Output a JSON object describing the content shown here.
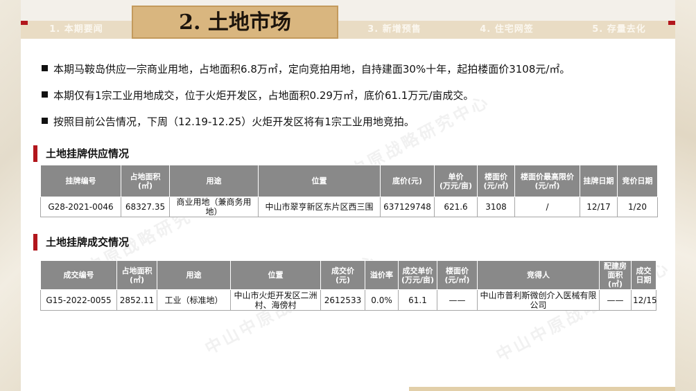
{
  "tabs": [
    "1. 本期要闻",
    "2. 土地市场",
    "3. 新增预售",
    "4. 住宅网签",
    "5. 存量去化"
  ],
  "bullets": [
    "本期马鞍岛供应一宗商业用地，占地面积6.8万㎡，定向竞拍用地，自持建面30%十年，起拍楼面价3108元/㎡。",
    "本期仅有1宗工业用地成交，位于火炬开发区，占地面积0.29万㎡，底价61.1万元/亩成交。",
    "按照目前公告情况，下周（12.19-12.25）火炬开发区将有1宗工业用地竞拍。"
  ],
  "supply": {
    "title": "土地挂牌供应情况",
    "headers": [
      "挂牌编号",
      "占地面积\n(㎡)",
      "用途",
      "位置",
      "底价(元)",
      "单价\n(万元/亩)",
      "楼面价\n(元/㎡)",
      "楼面价最高限价\n(元/㎡)",
      "挂牌日期",
      "竞价日期"
    ],
    "rows": [
      [
        "G28-2021-0046",
        "68327.35",
        "商业用地（兼商务用地）",
        "中山市翠亨新区东片区西三围",
        "637129748",
        "621.6",
        "3108",
        "/",
        "12/17",
        "1/20"
      ]
    ]
  },
  "deal": {
    "title": "土地挂牌成交情况",
    "headers": [
      "成交编号",
      "占地面积\n(㎡)",
      "用途",
      "位置",
      "成交价\n(元)",
      "溢价率",
      "成交单价\n(万元/亩)",
      "楼面价\n(元/㎡)",
      "竞得人",
      "配建房\n面积(㎡)",
      "成交\n日期"
    ],
    "rows": [
      [
        "G15-2022-0055",
        "2852.11",
        "工业（标准地）",
        "中山市火炬开发区二洲村、海傍村",
        "2612533",
        "0.0%",
        "61.1",
        "——",
        "中山市普利斯微创介入医械有限公司",
        "——",
        "12/15"
      ]
    ]
  },
  "watermark": "中山中原战略研究中心"
}
